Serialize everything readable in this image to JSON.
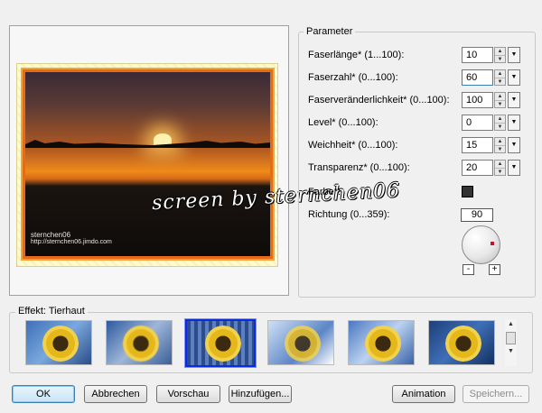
{
  "preview": {
    "caption_line1": "sternchen06",
    "caption_line2": "http://sternchen06.jimdo.com",
    "watermark": "screen by sternchen06"
  },
  "parameters": {
    "group_title": "Parameter",
    "rows": [
      {
        "label": "Faserlänge* (1...100):",
        "value": "10"
      },
      {
        "label": "Faserzahl* (0...100):",
        "value": "60"
      },
      {
        "label": "Faserveränderlichkeit* (0...100):",
        "value": "100"
      },
      {
        "label": "Level* (0...100):",
        "value": "0"
      },
      {
        "label": "Weichheit* (0...100):",
        "value": "15"
      },
      {
        "label": "Transparenz* (0...100):",
        "value": "20"
      }
    ],
    "color_label": "Farbe*:",
    "color_value": "#333333",
    "direction_label": "Richtung (0...359):",
    "direction_value": "90",
    "minus_label": "-",
    "plus_label": "+"
  },
  "effects": {
    "group_title": "Effekt: Tierhaut",
    "thumbnails": [
      "effect-1",
      "effect-2",
      "effect-3-selected",
      "effect-4",
      "effect-5",
      "effect-6"
    ],
    "selected_index": 2
  },
  "buttons": {
    "ok": "OK",
    "cancel": "Abbrechen",
    "preview": "Vorschau",
    "add": "Hinzufügen...",
    "animation": "Animation",
    "save": "Speichern..."
  },
  "colors": {
    "accent_selection": "#0a2be0",
    "default_button": "#3c7fb1"
  }
}
